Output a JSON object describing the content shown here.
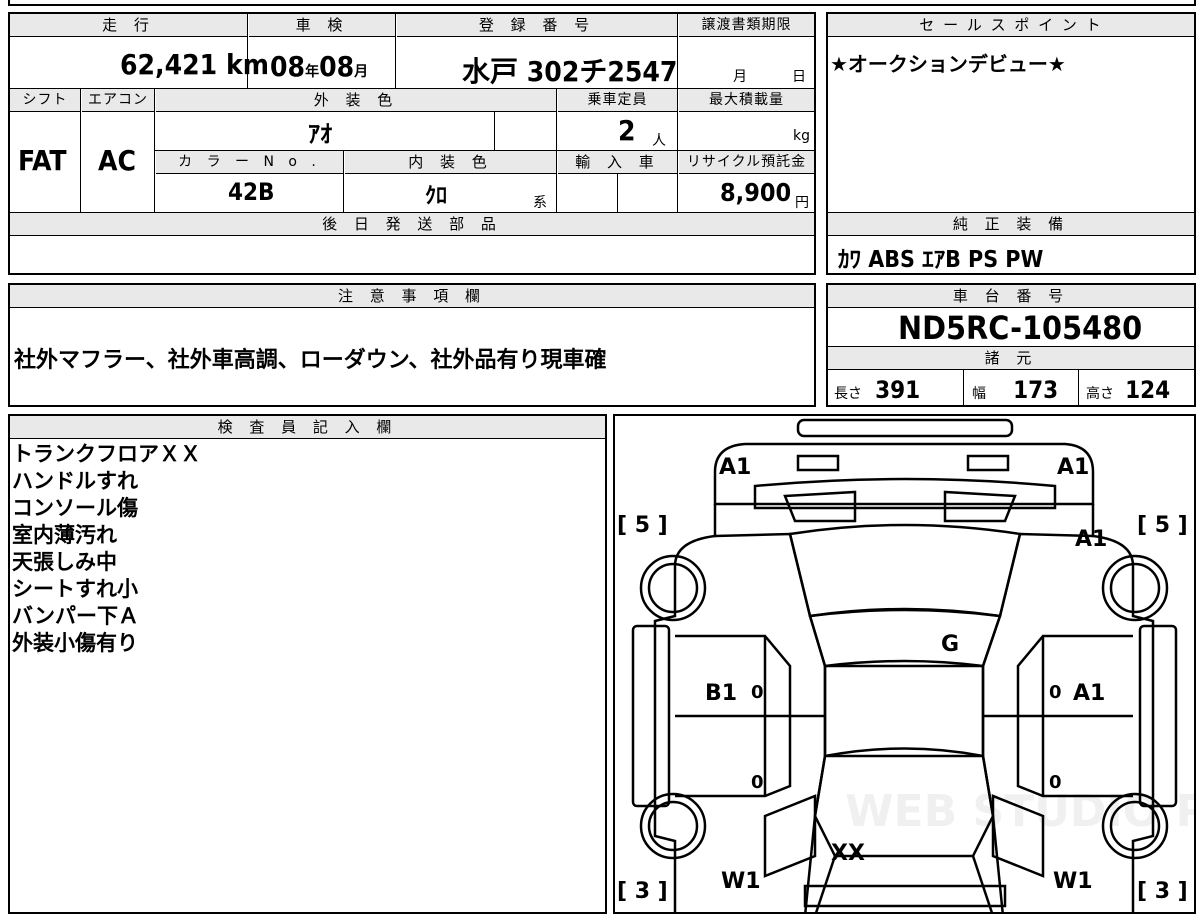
{
  "mileage": {
    "label": "走 行",
    "value": "62,421",
    "unit": "km"
  },
  "inspection": {
    "label": "車 検",
    "year": "08",
    "year_unit": "年",
    "month": "08",
    "month_unit": "月"
  },
  "registration": {
    "label": "登 録 番 号",
    "value": "水戸 302チ2547"
  },
  "transfer_deadline": {
    "label": "譲渡書類期限",
    "month_unit": "月",
    "day_unit": "日"
  },
  "selling_point": {
    "label": "セ ー ル ス ポ イ ン ト",
    "text": "★オークションデビュー★"
  },
  "shift": {
    "label": "シフト",
    "value": "FAT"
  },
  "aircon": {
    "label": "エアコン",
    "value": "AC"
  },
  "exterior_color": {
    "label": "外 装 色",
    "value": "ｱｵ"
  },
  "capacity": {
    "label": "乗車定員",
    "value": "2",
    "unit": "人"
  },
  "max_load": {
    "label": "最大積載量",
    "unit": "kg"
  },
  "color_no": {
    "label": "カ ラ ー N o .",
    "value": "42B"
  },
  "interior_color": {
    "label": "内 装 色",
    "value": "ｸﾛ",
    "suffix": "系"
  },
  "import_car": {
    "label": "輸 入 車"
  },
  "recycle": {
    "label": "リサイクル預託金",
    "value": "8,900",
    "unit": "円"
  },
  "later_parts": {
    "label": "後 日 発 送 部 品"
  },
  "equipment": {
    "label": "純 正 装 備",
    "value": "ｶﾜ ABS ｴｱB PS PW"
  },
  "notes": {
    "label": "注 意 事 項 欄",
    "text": "社外マフラー、社外車高調、ローダウン、社外品有り現車確"
  },
  "chassis": {
    "label": "車 台 番 号",
    "value": "ND5RC-105480"
  },
  "specs": {
    "label": "諸 元",
    "length_label": "長さ",
    "length": "391",
    "width_label": "幅",
    "width": "173",
    "height_label": "高さ",
    "height": "124"
  },
  "inspector": {
    "label": "検 査 員 記 入 欄",
    "lines": [
      "トランクフロアＸＸ",
      "ハンドルすれ",
      "コンソール傷",
      "室内薄汚れ",
      "天張しみ中",
      "シートすれ小",
      "バンパー下Ａ",
      "外装小傷有り"
    ]
  },
  "diagram": {
    "marks": {
      "a1_top_left": "A1",
      "a1_top_right": "A1",
      "a1_right": "A1",
      "g": "G",
      "b1": "B1",
      "a1_mid_right": "A1",
      "xx": "XX",
      "w1_left": "W1",
      "w1_right": "W1",
      "z1": "0",
      "z2": "0",
      "z3": "0",
      "z4": "0"
    },
    "tires": {
      "front_left": "[ 5 ]",
      "front_right": "[ 5 ]",
      "rear_left": "[ 3 ]",
      "rear_right": "[ 3 ]"
    },
    "watermark": "WEB STUDIO PRO"
  }
}
